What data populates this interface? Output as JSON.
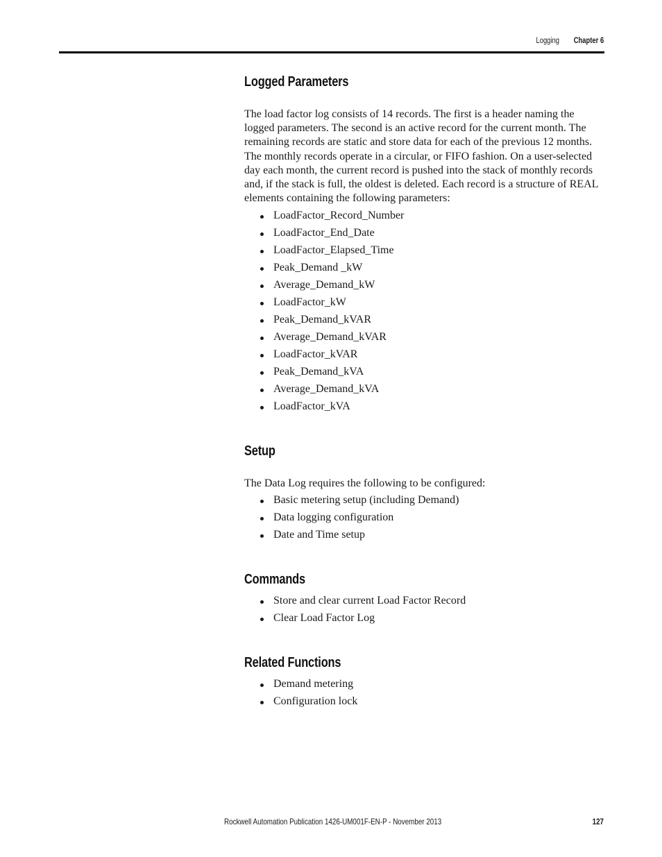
{
  "header": {
    "section": "Logging",
    "chapter": "Chapter 6"
  },
  "sections": {
    "logged_parameters": {
      "heading": "Logged Parameters",
      "paragraph": "The load factor log consists of 14 records. The first is a header naming the logged parameters. The second is an active record for the current month. The remaining records are static and store data for each of the previous 12 months. The monthly records operate in a circular, or FIFO fashion. On a user-selected day each month, the current record is pushed into the stack of monthly records and, if the stack is full, the oldest is deleted. Each record is a structure of REAL elements containing the following parameters:",
      "items": [
        "LoadFactor_Record_Number",
        "LoadFactor_End_Date",
        "LoadFactor_Elapsed_Time",
        "Peak_Demand _kW",
        "Average_Demand_kW",
        "LoadFactor_kW",
        "Peak_Demand_kVAR",
        "Average_Demand_kVAR",
        "LoadFactor_kVAR",
        "Peak_Demand_kVA",
        "Average_Demand_kVA",
        "LoadFactor_kVA"
      ]
    },
    "setup": {
      "heading": "Setup",
      "paragraph": "The Data Log requires the following to be configured:",
      "items": [
        "Basic metering setup (including Demand)",
        "Data logging configuration",
        "Date and Time setup"
      ]
    },
    "commands": {
      "heading": "Commands",
      "items": [
        "Store and clear current Load Factor Record",
        "Clear Load Factor Log"
      ]
    },
    "related_functions": {
      "heading": "Related Functions",
      "items": [
        "Demand metering",
        "Configuration lock"
      ]
    }
  },
  "footer": {
    "publication": "Rockwell Automation Publication 1426-UM001F-EN-P - November 2013",
    "page_number": "127"
  }
}
